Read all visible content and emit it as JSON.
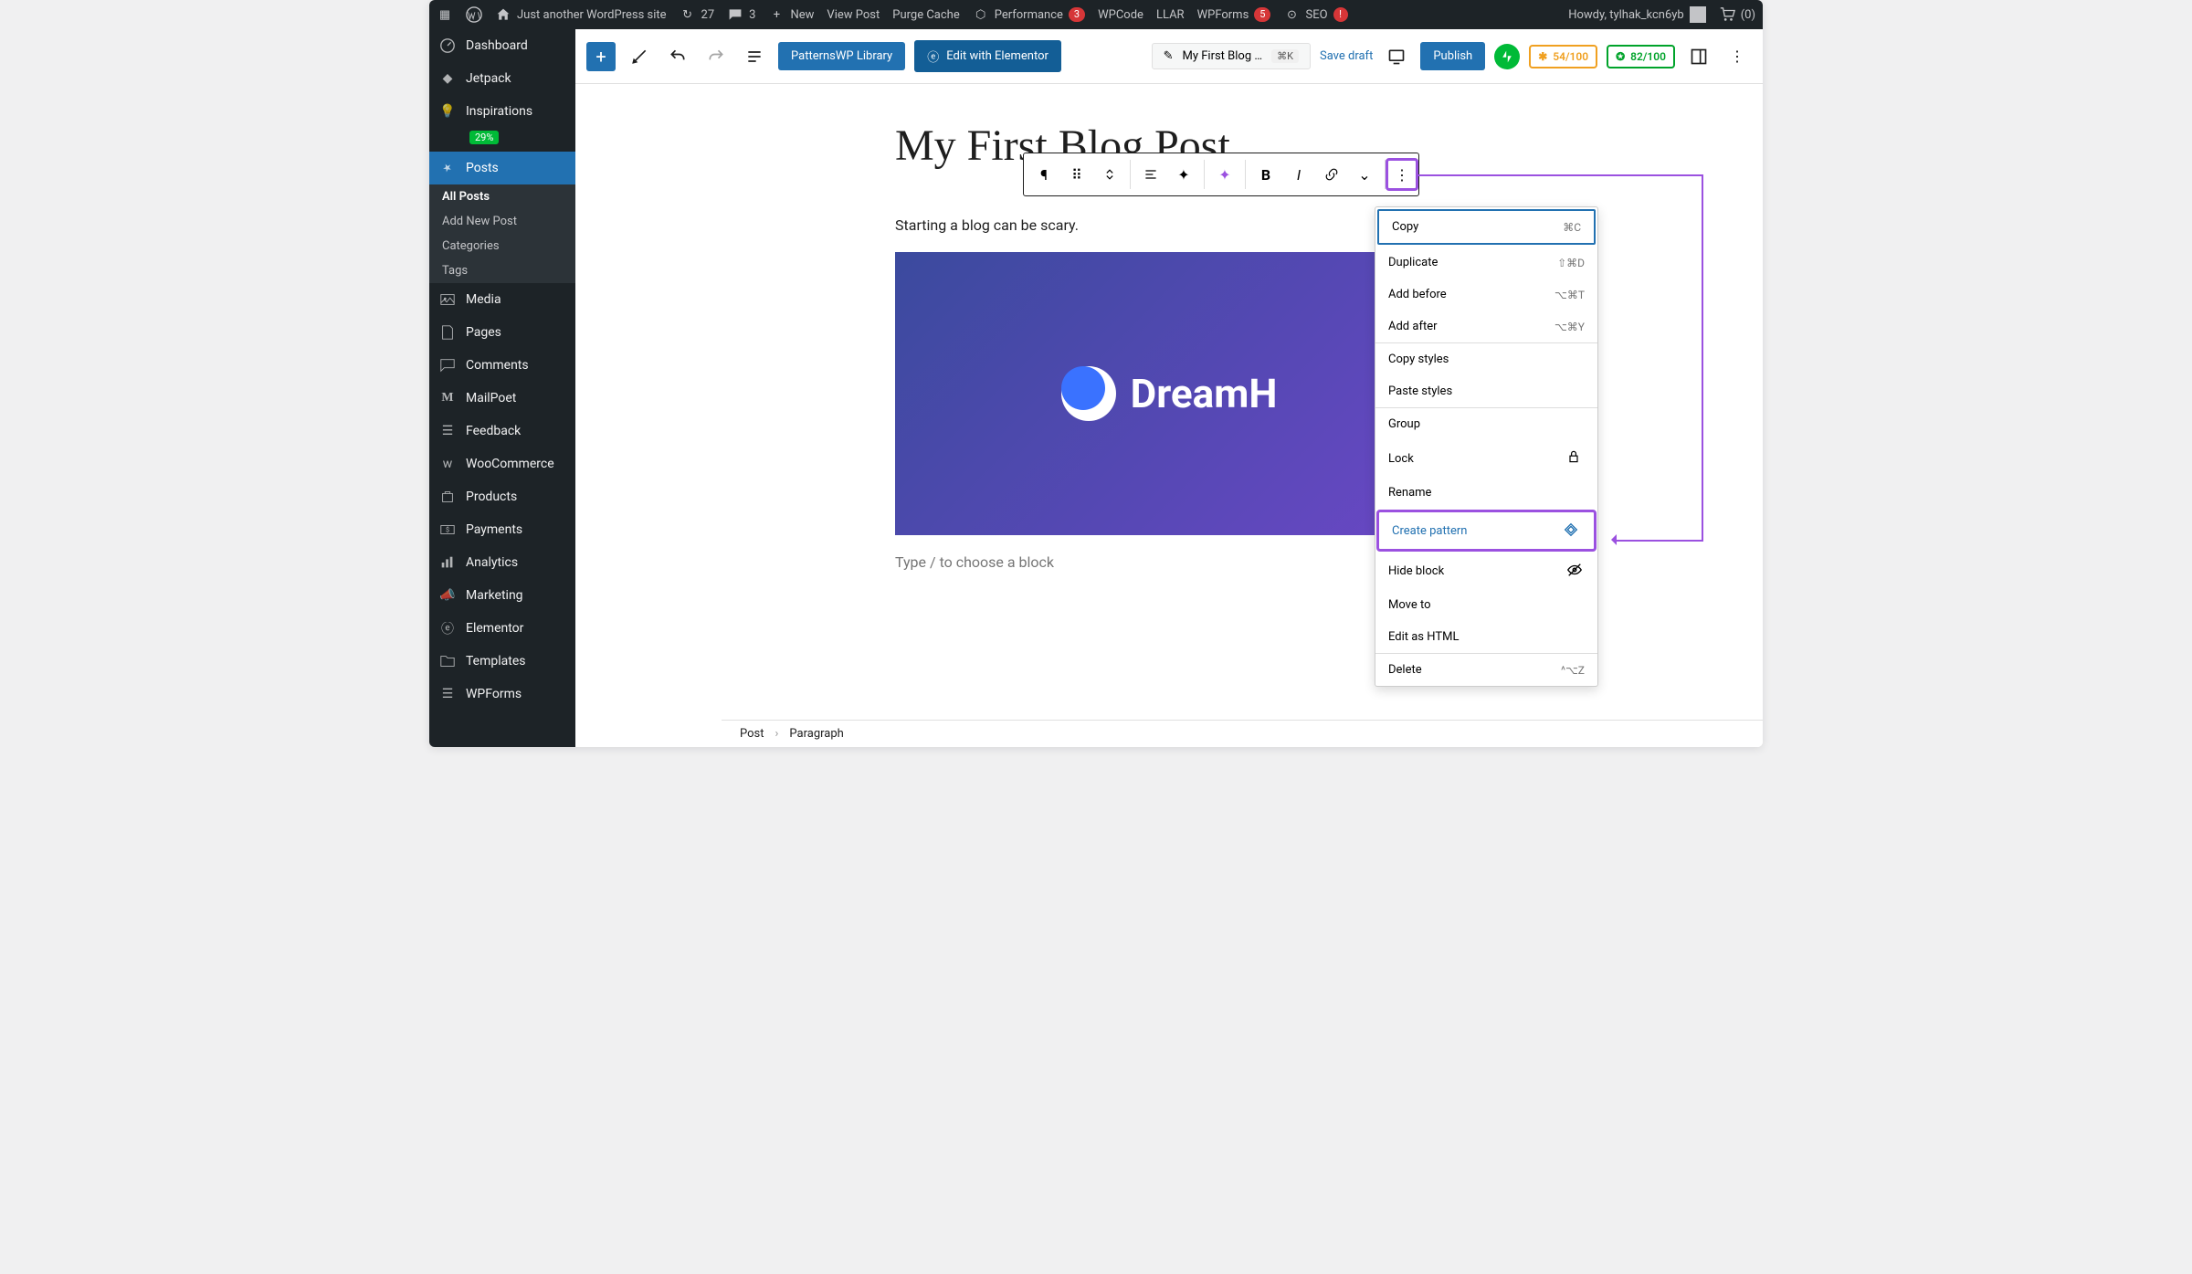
{
  "adminbar": {
    "site_name": "Just another WordPress site",
    "updates": "27",
    "comments": "3",
    "new": "New",
    "view_post": "View Post",
    "purge_cache": "Purge Cache",
    "performance": "Performance",
    "perf_badge": "3",
    "wpcode": "WPCode",
    "llar": "LLAR",
    "wpforms": "WPForms",
    "wpforms_badge": "5",
    "seo": "SEO",
    "howdy": "Howdy, tylhak_kcn6yb",
    "cart": "(0)"
  },
  "sidebar": {
    "dashboard": "Dashboard",
    "jetpack": "Jetpack",
    "inspirations": "Inspirations",
    "insp_pct": "29%",
    "posts": "Posts",
    "all_posts": "All Posts",
    "add_new": "Add New Post",
    "categories": "Categories",
    "tags": "Tags",
    "media": "Media",
    "pages": "Pages",
    "comments": "Comments",
    "mailpoet": "MailPoet",
    "feedback": "Feedback",
    "woocommerce": "WooCommerce",
    "products": "Products",
    "payments": "Payments",
    "analytics": "Analytics",
    "marketing": "Marketing",
    "elementor": "Elementor",
    "templates": "Templates",
    "wpforms": "WPForms"
  },
  "toolbar": {
    "patterns_lib": "PatternsWP Library",
    "edit_elementor": "Edit with Elementor",
    "doc_title": "My First Blog …",
    "doc_short": "⌘K",
    "save_draft": "Save draft",
    "publish": "Publish",
    "score1": "54/100",
    "score2": "82/100"
  },
  "post": {
    "title": "My First Blog Post",
    "paragraph": "Starting a blog can be scary.",
    "image_text": "DreamH",
    "placeholder": "Type / to choose a block"
  },
  "context_menu": {
    "copy": "Copy",
    "copy_k": "⌘C",
    "duplicate": "Duplicate",
    "dup_k": "⇧⌘D",
    "add_before": "Add before",
    "ab_k": "⌥⌘T",
    "add_after": "Add after",
    "aa_k": "⌥⌘Y",
    "copy_styles": "Copy styles",
    "paste_styles": "Paste styles",
    "group": "Group",
    "lock": "Lock",
    "rename": "Rename",
    "create_pattern": "Create pattern",
    "hide_block": "Hide block",
    "move_to": "Move to",
    "edit_html": "Edit as HTML",
    "delete": "Delete",
    "del_k": "^⌥Z"
  },
  "breadcrumb": {
    "post": "Post",
    "para": "Paragraph"
  }
}
